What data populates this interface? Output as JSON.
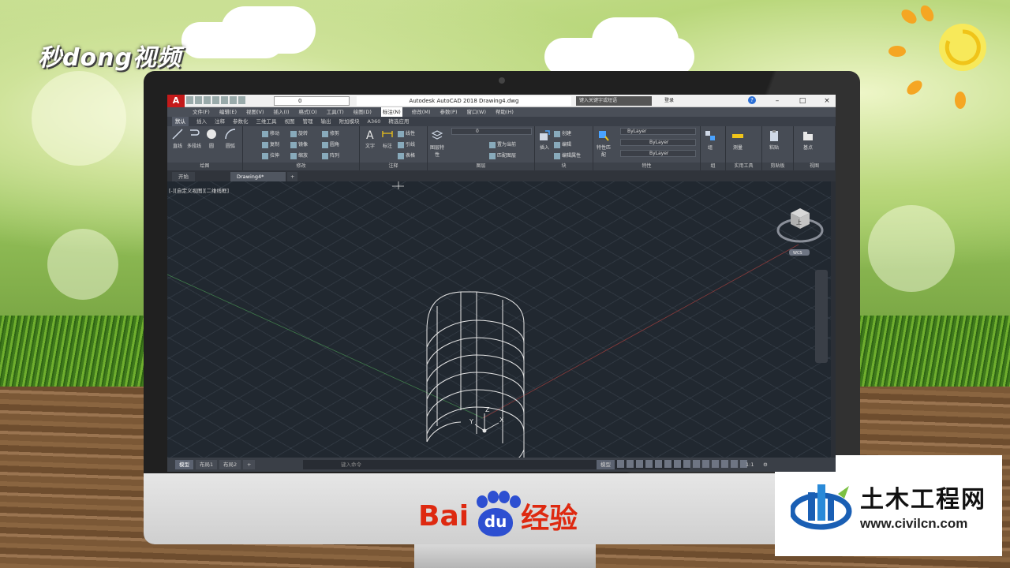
{
  "overlay": {
    "top_left_logo": "秒dong视频",
    "baidu_left": "Bai",
    "baidu_paw": "du",
    "baidu_right": "经验",
    "civil_name": "土木工程网",
    "civil_url": "www.civilcn.com"
  },
  "colors": {
    "accent_red": "#c41a1a",
    "baidu_blue": "#2d4fd1",
    "baidu_red": "#de2910",
    "canvas": "#212830"
  },
  "titlebar": {
    "app_icon": "A",
    "layer_value": "0",
    "title": "Autodesk AutoCAD 2018    Drawing4.dwg",
    "search_placeholder": "键入关键字或短语",
    "login": "登录",
    "help": "?"
  },
  "menu": [
    "文件(F)",
    "编辑(E)",
    "视图(V)",
    "插入(I)",
    "格式(O)",
    "工具(T)",
    "绘图(D)",
    "标注(N)",
    "修改(M)",
    "参数(P)",
    "窗口(W)",
    "帮助(H)"
  ],
  "ribbon_tabs": [
    "默认",
    "插入",
    "注释",
    "参数化",
    "三维工具",
    "视图",
    "管理",
    "输出",
    "附加模块",
    "A360",
    "精选应用"
  ],
  "ribbon": {
    "draw": {
      "label": "绘图",
      "line": "直线",
      "polyline": "多段线",
      "circle": "圆",
      "arc": "圆弧"
    },
    "modify": {
      "label": "修改",
      "move": "移动",
      "rotate": "旋转",
      "trim": "修剪",
      "copy": "复制",
      "mirror": "镜像",
      "fillet": "圆角",
      "stretch": "拉伸",
      "scale": "缩放",
      "array": "阵列"
    },
    "annotation": {
      "label": "注释",
      "text": "文字",
      "dimension": "标注",
      "linear": "线性",
      "leader": "引线",
      "table": "表格"
    },
    "layers": {
      "label": "图层",
      "layer_props": "图层特性",
      "layer_value": "0",
      "make_current": "置为当前",
      "match_layer": "匹配图层"
    },
    "block": {
      "label": "块",
      "insert": "插入",
      "create": "创建",
      "edit": "编辑",
      "edit_attr": "编辑属性"
    },
    "properties": {
      "label": "特性",
      "match": "特性匹配",
      "color": "ByLayer",
      "linetype": "ByLayer",
      "lineweight": "ByLayer"
    },
    "groups": {
      "label": "组",
      "group": "组"
    },
    "utilities": {
      "label": "实用工具",
      "measure": "测量"
    },
    "clipboard": {
      "label": "剪贴板",
      "paste": "粘贴"
    },
    "view": {
      "label": "视图",
      "base": "基点"
    }
  },
  "doc_tabs": [
    "开始",
    "Drawing4*"
  ],
  "viewport_label": "[-][自定义视图][二维线框]",
  "viewcube": {
    "face": "上",
    "wcs": "WCS"
  },
  "ucs": {
    "x": "X",
    "y": "Y",
    "z": "Z"
  },
  "layout_tabs": [
    "模型",
    "布局1",
    "布局2"
  ],
  "command_placeholder": "键入命令",
  "status": {
    "mode": "模型",
    "scale": "1:1"
  }
}
